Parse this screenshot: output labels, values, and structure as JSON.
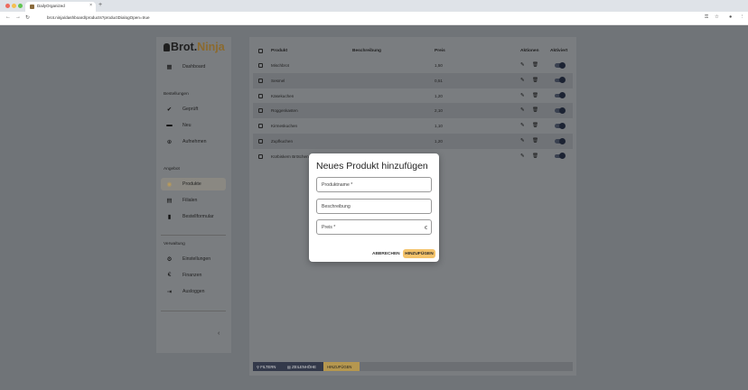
{
  "browser": {
    "tab_title": "DailyOrganized",
    "tab_close": "×",
    "new_tab": "+",
    "url": "brot.ninja/dashboard/products?productDialogOpen=true",
    "nav": {
      "back": "←",
      "forward": "→",
      "reload": "↻"
    },
    "icons": {
      "key": "⚿",
      "star": "☆",
      "profile": "●",
      "menu": "⋮"
    }
  },
  "sidebar": {
    "logo_main": "Brot.",
    "logo_accent": "Ninja",
    "dashboard": {
      "label": "Dashboard",
      "icon": "▦"
    },
    "section_orders": "Bestellungen",
    "orders": [
      {
        "label": "Geprüft",
        "icon": "✔"
      },
      {
        "label": "Neu",
        "icon": "▬"
      },
      {
        "label": "Aufnehmen",
        "icon": "⊕"
      }
    ],
    "section_offer": "Angebot",
    "offer": [
      {
        "label": "Produkte",
        "icon": "◉",
        "active": true
      },
      {
        "label": "Filialen",
        "icon": "▤"
      },
      {
        "label": "Bestellformular",
        "icon": "▮"
      }
    ],
    "section_admin": "Verwaltung",
    "admin": [
      {
        "label": "Einstellungen",
        "icon": "⚙"
      },
      {
        "label": "Finanzen",
        "icon": "€"
      },
      {
        "label": "Ausloggen",
        "icon": "⇥"
      }
    ],
    "collapse_icon": "‹"
  },
  "table": {
    "headers": {
      "product": "Produkt",
      "description": "Beschreibung",
      "price": "Preis",
      "actions": "Aktionen",
      "active": "Aktiviert"
    },
    "rows": [
      {
        "product": "Mischbrot",
        "price": "1,50"
      },
      {
        "product": "Sesmel",
        "price": "0,51"
      },
      {
        "product": "Käsekuchen",
        "price": "1,20"
      },
      {
        "product": "Roggenkasten",
        "price": "2,10"
      },
      {
        "product": "Kirmeskuchen",
        "price": "1,10"
      },
      {
        "product": "Zupfkuchen",
        "price": "1,20"
      },
      {
        "product": "Kürbiskern Brötchen",
        "price": ""
      }
    ],
    "edit_icon": "✎",
    "delete_icon": "🗑"
  },
  "bottom_bar": {
    "filter": "FILTERN",
    "columns": "ZEILENHÖHE",
    "add": "HINZUFÜGEN"
  },
  "dialog": {
    "title": "Neues Produkt hinzufügen",
    "name_placeholder": "Produktname *",
    "description_placeholder": "Beschreibung",
    "price_placeholder": "Preis *",
    "currency": "€",
    "cancel": "ABBRECHEN",
    "add": "HINZUFÜGEN"
  },
  "colors": {
    "accent": "#f4c36a",
    "brand": "#8b6a2e",
    "overlay": "#707478"
  }
}
